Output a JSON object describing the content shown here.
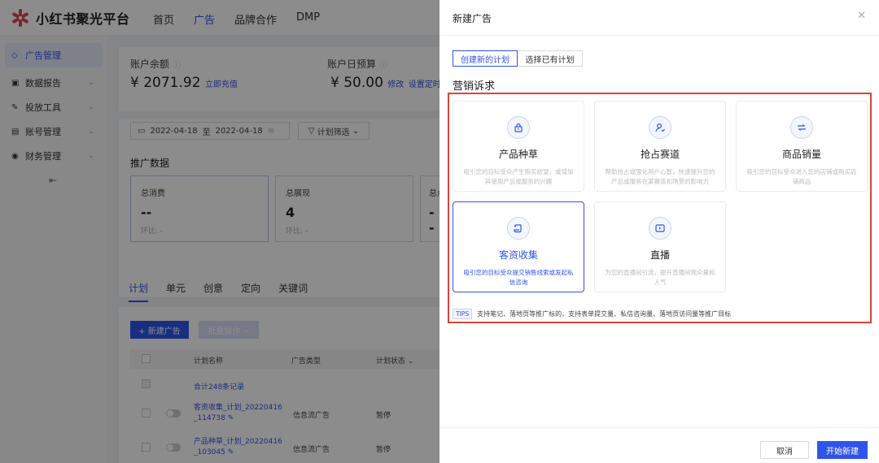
{
  "brand": {
    "name": "小红书聚光平台",
    "color": "#e2424c"
  },
  "accent_color": "#2f54eb",
  "highlight_color": "#d9443a",
  "topnav": [
    "首页",
    "广告",
    "品牌合作",
    "DMP"
  ],
  "sidebar": {
    "items": [
      {
        "label": "广告管理",
        "icon": "tag-icon"
      },
      {
        "label": "数据报告",
        "icon": "report-icon"
      },
      {
        "label": "投放工具",
        "icon": "tool-icon"
      },
      {
        "label": "账号管理",
        "icon": "account-icon"
      },
      {
        "label": "财务管理",
        "icon": "finance-icon"
      }
    ],
    "collapse_icon": "collapse-icon"
  },
  "balance": {
    "balance_label": "账户余额",
    "balance_value": "¥ 2071.92",
    "recharge_link": "立即充值",
    "budget_label": "账户日预算",
    "budget_value": "¥ 50.00",
    "edit_link": "修改",
    "set_link": "设置定时"
  },
  "filters": {
    "date_start": "2022-04-18",
    "date_sep": "至",
    "date_end": "2022-04-18",
    "plan_filter": "计划筛选"
  },
  "promo": {
    "title": "推广数据",
    "metrics": [
      {
        "label": "总消费",
        "value": "--",
        "compare": "环比: -"
      },
      {
        "label": "总展现",
        "value": "4",
        "compare": "环比: -"
      },
      {
        "label": "总点",
        "value": "--"
      }
    ]
  },
  "tabs": [
    "计划",
    "单元",
    "创意",
    "定向",
    "关键词"
  ],
  "actions": {
    "new_ad": "+ 新建广告",
    "batch": "批量操作"
  },
  "table": {
    "columns": [
      "计划名称",
      "广告类型",
      "计划状态"
    ],
    "summary": "合计248条记录",
    "rows": [
      {
        "name": "客资收集_计划_20220416_114738",
        "name_line1": "客资收集_计划_20220416",
        "name_line2": "_114738",
        "type": "信息流广告",
        "status": "暂停"
      },
      {
        "name": "产品种草_计划_20220416_103045",
        "name_line1": "产品种草_计划_20220416",
        "name_line2": "_103045",
        "type": "信息流广告",
        "status": "暂停"
      }
    ]
  },
  "drawer": {
    "title": "新建广告",
    "segments": [
      "创建新的计划",
      "选择已有计划"
    ],
    "goal_title": "营销诉求",
    "objectives": [
      {
        "name": "产品种草",
        "desc": "吸引您的目标受众产生购买欲望，或增加其使用产品或服务的兴趣",
        "icon": "lock-icon"
      },
      {
        "name": "抢占赛道",
        "desc": "帮助抢占或强化用户心智，快速提升您的产品或服务在某赛道和场景的影响力",
        "icon": "user-icon"
      },
      {
        "name": "商品销量",
        "desc": "吸引您的目标受众进入您的店铺或购买店铺商品",
        "icon": "refresh-icon"
      },
      {
        "name": "客资收集",
        "desc": "吸引您的目标受众提交销售线索或发起私信咨询",
        "icon": "scroll-icon"
      },
      {
        "name": "直播",
        "desc": "为您的直播间引流，提升直播间观众量和人气",
        "icon": "live-icon"
      }
    ],
    "tips_badge": "TIPS",
    "tips_text": "支持笔记、落地页等推广标的，支持表单提交量、私信咨询量、落地页访问量等推广目标",
    "cancel": "取消",
    "start": "开始新建",
    "close_icon": "close-icon"
  }
}
